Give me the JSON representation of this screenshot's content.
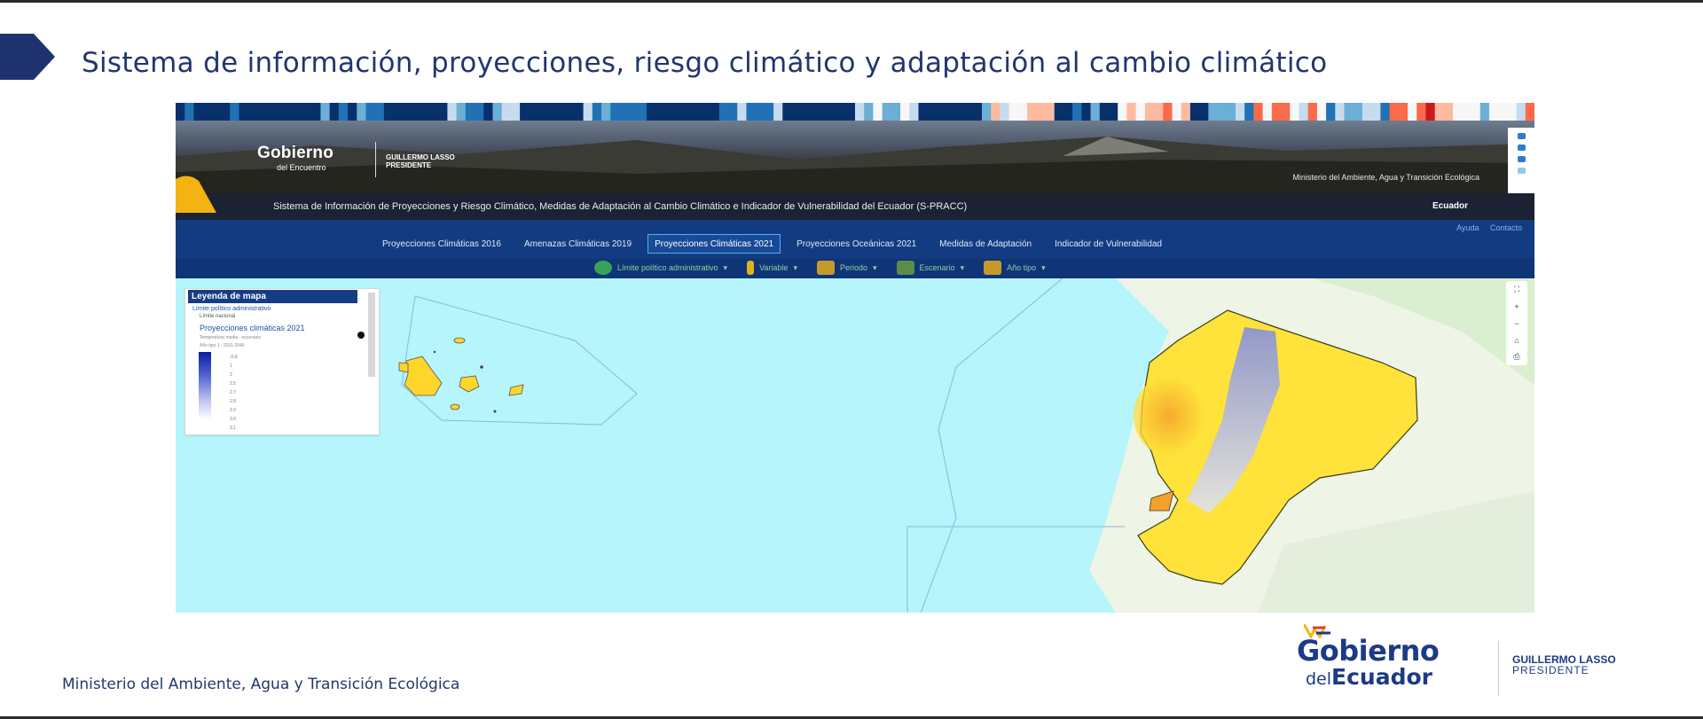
{
  "slide": {
    "title": "Sistema de información, proyecciones, riesgo climático y adaptación al cambio climático",
    "footer_org": "Ministerio del Ambiente, Agua y Transición Ecológica",
    "logo_line1": "Gobierno",
    "logo_line2_prefix": "del",
    "logo_line2": "Ecuador",
    "president_name": "GUILLERMO LASSO",
    "president_title": "PRESIDENTE"
  },
  "site": {
    "banner_logo": "Gobierno",
    "banner_logo_sub": "del Encuentro",
    "banner_person_name": "GUILLERMO LASSO",
    "banner_person_title": "PRESIDENTE",
    "ministry": "Ministerio del Ambiente, Agua y Transición Ecológica",
    "system_title": "Sistema de Información de Proyecciones y Riesgo Climático, Medidas de Adaptación al Cambio Climático e Indicador de Vulnerabilidad del Ecuador (S-PRACC)",
    "country": "Ecuador"
  },
  "nav": {
    "aux": [
      "Ayuda",
      "Contacto"
    ],
    "tabs": [
      {
        "label": "Proyecciones Climáticas 2016",
        "active": false
      },
      {
        "label": "Amenazas Climáticas 2019",
        "active": false
      },
      {
        "label": "Proyecciones Climáticas 2021",
        "active": true
      },
      {
        "label": "Proyecciones Oceánicas 2021",
        "active": false
      },
      {
        "label": "Medidas de Adaptación",
        "active": false
      },
      {
        "label": "Indicador de Vulnerabilidad",
        "active": false
      }
    ]
  },
  "toolbar": {
    "tools": [
      {
        "label": "Límite político administrativo",
        "icon": "map-pin-icon",
        "color": "#3aa35a"
      },
      {
        "label": "Variable",
        "icon": "thermometer-icon",
        "color": "#e2b21c"
      },
      {
        "label": "Periodo",
        "icon": "calendar-icon",
        "color": "#c59a2a"
      },
      {
        "label": "Escenario",
        "icon": "layers-icon",
        "color": "#5c8c4a"
      },
      {
        "label": "Año tipo",
        "icon": "calendar-icon",
        "color": "#c59a2a"
      }
    ]
  },
  "legend": {
    "title": "Leyenda de mapa",
    "line1": "Límite político administrativo",
    "line2": "Límite nacional",
    "line3": "Proyecciones climáticas 2021",
    "small1": "Temperatura media - escenario",
    "small2": "Año tipo 1 - 2011-2040",
    "ticks": [
      "-0.8",
      "1",
      "2",
      "2.5",
      "2.7",
      "2.8",
      "2.9",
      "3.0",
      "3.1"
    ]
  },
  "map_controls": [
    "⛶",
    "+",
    "−",
    "⌂",
    "⎙"
  ],
  "colors": {
    "navbar": "#123b82",
    "accent_title": "#22356e",
    "map_ocean": "#b5f5fb",
    "projection_warm": "#ffe23a",
    "projection_hot": "#f7a02a",
    "projection_cool": "#9aa5e8"
  }
}
